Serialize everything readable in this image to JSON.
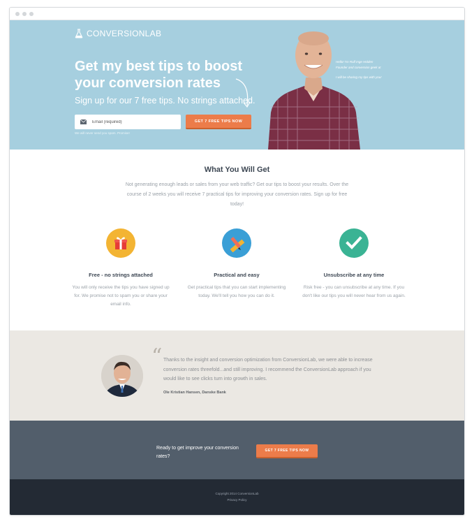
{
  "window": {
    "dots": 3
  },
  "header": {
    "logo_text": "CONVERSIONLAB"
  },
  "hero": {
    "headline": "Get my best tips to boost your conversion rates",
    "subline": "Sign up for our 7 free tips. No strings attached.",
    "email_placeholder": "Email (required)",
    "cta_label": "GET 7 FREE TIPS NOW",
    "spam_note": "We will never send you spam. Promise!",
    "bio_line1": "Hello! I'm Rolf Inge Holden",
    "bio_line2": "Founder and conversion geek at",
    "bio_line3": "I will be sharing my tips with you!"
  },
  "what_you_get": {
    "title": "What You Will Get",
    "intro": "Not generating enough leads or sales from your web traffic? Get our tips to boost your results. Over the course of 2 weeks you will receive 7 practical tips for improving your conversion rates. Sign up for free today!"
  },
  "features": [
    {
      "title": "Free - no strings attached",
      "text": "You will only receive the tips you have signed up for. We promise not to spam you or share your email info.",
      "icon": "gift-icon",
      "color": "#f3b433"
    },
    {
      "title": "Practical and easy",
      "text": "Get practical tips that you can start implementing today. We'll tell you how you can do it.",
      "icon": "pencil-ruler-icon",
      "color": "#3a9fd6"
    },
    {
      "title": "Unsubscribe at any time",
      "text": "Risk free - you can unsubscribe at any time. If you don't like our tips you will never hear from us again.",
      "icon": "checkmark-icon",
      "color": "#3ab394"
    }
  ],
  "testimonial": {
    "quote": "Thanks to the insight and conversion optimization from ConversionLab, we were able to increase conversion rates threefold...and still improving. I recommend the ConversionLab approach if you would like to see clicks turn into growth in sales.",
    "author": "Ole Kristian Hansen, Danske Bank"
  },
  "cta_band": {
    "text": "Ready to get improve your conversion rates?",
    "button_label": "GET 7 FREE TIPS NOW"
  },
  "footer": {
    "copyright": "Copyright 2014 ConversionLab",
    "privacy": "Privacy Policy"
  },
  "colors": {
    "hero_bg": "#a6cfdf",
    "accent": "#ec7c4a",
    "testimonial_bg": "#ebe8e3",
    "cta_bg": "#525e6b",
    "footer_bg": "#232a34"
  }
}
